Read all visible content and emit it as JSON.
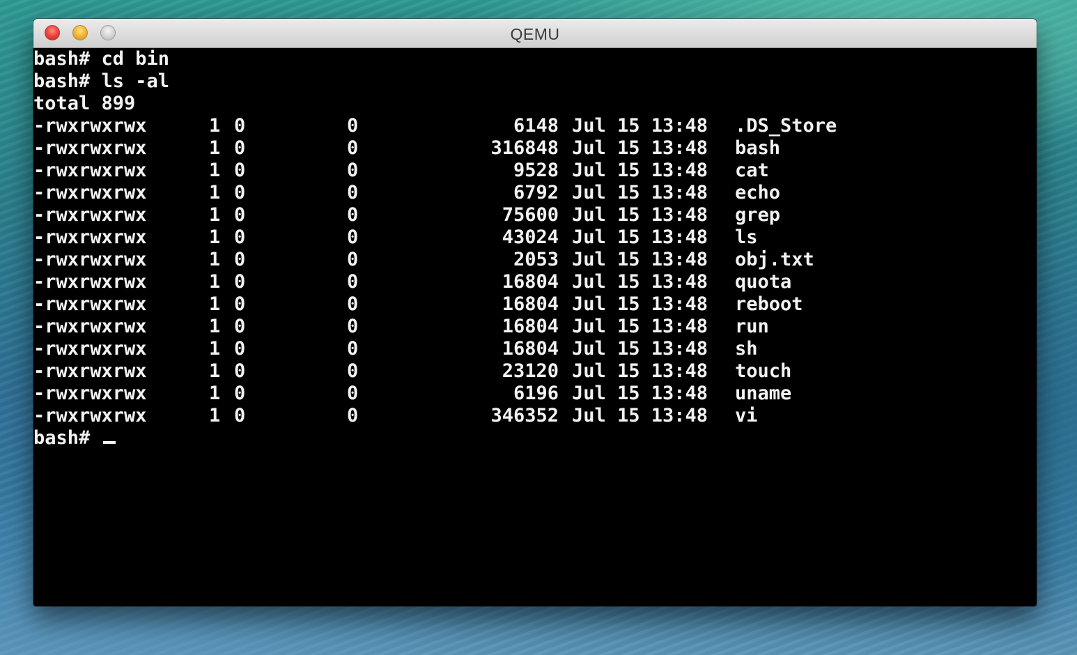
{
  "window": {
    "title": "QEMU"
  },
  "terminal": {
    "lines_before": [
      "bash# cd bin",
      "bash# ls -al",
      "total 899"
    ],
    "rows": [
      {
        "perm": "-rwxrwxrwx",
        "links": "1",
        "uid": "0",
        "gid": "0",
        "size": "6148",
        "date": "Jul 15 13:48",
        "name": ".DS_Store"
      },
      {
        "perm": "-rwxrwxrwx",
        "links": "1",
        "uid": "0",
        "gid": "0",
        "size": "316848",
        "date": "Jul 15 13:48",
        "name": "bash"
      },
      {
        "perm": "-rwxrwxrwx",
        "links": "1",
        "uid": "0",
        "gid": "0",
        "size": "9528",
        "date": "Jul 15 13:48",
        "name": "cat"
      },
      {
        "perm": "-rwxrwxrwx",
        "links": "1",
        "uid": "0",
        "gid": "0",
        "size": "6792",
        "date": "Jul 15 13:48",
        "name": "echo"
      },
      {
        "perm": "-rwxrwxrwx",
        "links": "1",
        "uid": "0",
        "gid": "0",
        "size": "75600",
        "date": "Jul 15 13:48",
        "name": "grep"
      },
      {
        "perm": "-rwxrwxrwx",
        "links": "1",
        "uid": "0",
        "gid": "0",
        "size": "43024",
        "date": "Jul 15 13:48",
        "name": "ls"
      },
      {
        "perm": "-rwxrwxrwx",
        "links": "1",
        "uid": "0",
        "gid": "0",
        "size": "2053",
        "date": "Jul 15 13:48",
        "name": "obj.txt"
      },
      {
        "perm": "-rwxrwxrwx",
        "links": "1",
        "uid": "0",
        "gid": "0",
        "size": "16804",
        "date": "Jul 15 13:48",
        "name": "quota"
      },
      {
        "perm": "-rwxrwxrwx",
        "links": "1",
        "uid": "0",
        "gid": "0",
        "size": "16804",
        "date": "Jul 15 13:48",
        "name": "reboot"
      },
      {
        "perm": "-rwxrwxrwx",
        "links": "1",
        "uid": "0",
        "gid": "0",
        "size": "16804",
        "date": "Jul 15 13:48",
        "name": "run"
      },
      {
        "perm": "-rwxrwxrwx",
        "links": "1",
        "uid": "0",
        "gid": "0",
        "size": "16804",
        "date": "Jul 15 13:48",
        "name": "sh"
      },
      {
        "perm": "-rwxrwxrwx",
        "links": "1",
        "uid": "0",
        "gid": "0",
        "size": "23120",
        "date": "Jul 15 13:48",
        "name": "touch"
      },
      {
        "perm": "-rwxrwxrwx",
        "links": "1",
        "uid": "0",
        "gid": "0",
        "size": "6196",
        "date": "Jul 15 13:48",
        "name": "uname"
      },
      {
        "perm": "-rwxrwxrwx",
        "links": "1",
        "uid": "0",
        "gid": "0",
        "size": "346352",
        "date": "Jul 15 13:48",
        "name": "vi"
      }
    ],
    "prompt": "bash# "
  }
}
